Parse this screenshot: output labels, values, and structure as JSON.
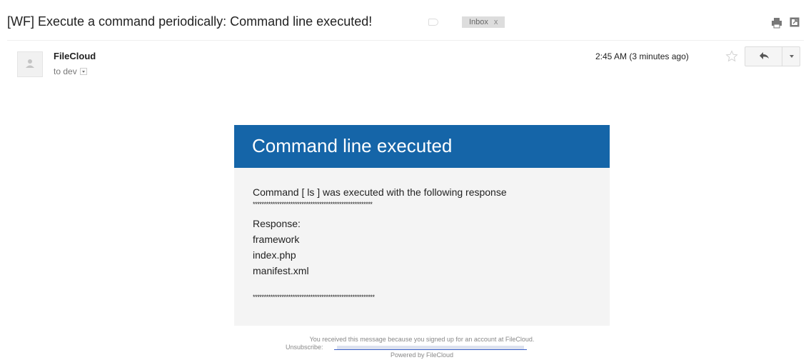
{
  "subject": {
    "title": "[WF] Execute a command periodically: Command line executed!",
    "label": "Inbox",
    "label_close": "x"
  },
  "sender": {
    "name": "FileCloud",
    "recipients": "to dev",
    "timestamp": "2:45 AM (3 minutes ago)"
  },
  "icons": {
    "avatar": "person-icon",
    "label_tag": "label-tag-icon",
    "print": "print-icon",
    "new_window": "new-window-icon",
    "star": "star-icon",
    "reply": "reply-icon",
    "more": "chevron-down-icon"
  },
  "email": {
    "title": "Command line executed",
    "intro": "Command [ ls ] was executed with the following response",
    "separator_top": "******************************************************",
    "response_label": "Response:",
    "response_lines": [
      "framework",
      "index.php",
      "manifest.xml"
    ],
    "separator_bottom": "*******************************************************"
  },
  "footer": {
    "notice": "You received this message because you signed up for an account at FileCloud.",
    "unsubscribe_label": "Unsubscribe:",
    "powered_by": "Powered by FileCloud"
  },
  "colors": {
    "header_blue": "#1565a8",
    "body_background": "#f4f4f4",
    "label_background": "#dddddd"
  }
}
